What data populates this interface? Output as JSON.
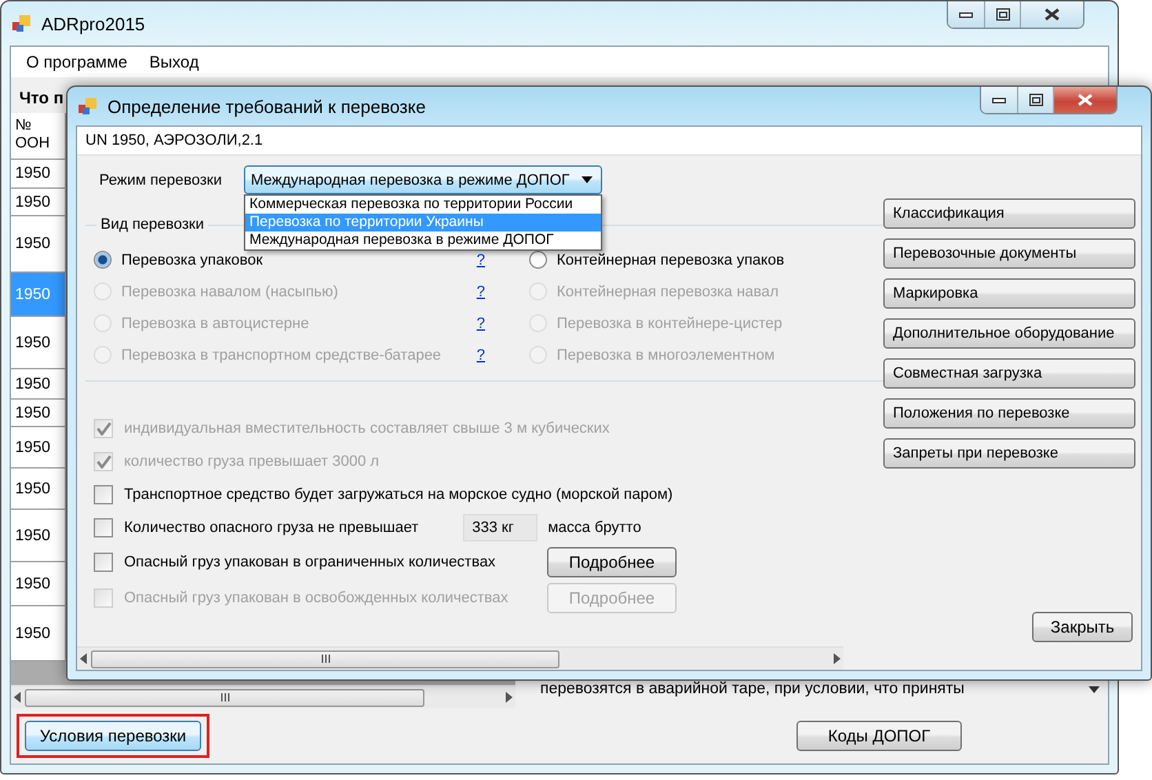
{
  "main_window": {
    "title": "ADRpro2015",
    "menu": [
      "О программе",
      "Выход"
    ],
    "section_label": "Что п",
    "table": {
      "columns": [
        "№ ООН"
      ],
      "rows": [
        {
          "un": "1950",
          "selected": false
        },
        {
          "un": "1950",
          "selected": false
        },
        {
          "un": "1950",
          "selected": false
        },
        {
          "un": "1950",
          "selected": true
        },
        {
          "un": "1950",
          "selected": false
        },
        {
          "un": "1950",
          "selected": false
        },
        {
          "un": "1950",
          "selected": false
        },
        {
          "un": "1950",
          "selected": false
        },
        {
          "un": "1950",
          "selected": false
        },
        {
          "un": "1950",
          "selected": false
        },
        {
          "un": "1950",
          "selected": false
        },
        {
          "un": "1950",
          "selected": false
        }
      ]
    },
    "description_text": "перевозятся в аварийной таре, при условии, что приняты",
    "buttons": [
      {
        "label": "Условия перевозки",
        "highlighted": true
      },
      {
        "label": "Коды ДОПОГ",
        "highlighted": false
      }
    ]
  },
  "dialog": {
    "title": "Определение требований к перевозке",
    "substance": "UN 1950, АЭРОЗОЛИ,2.1",
    "mode_label": "Режим перевозки",
    "mode_value": "Международная перевозка в режиме ДОПОГ",
    "mode_options": [
      {
        "label": "Коммерческая перевозка по территории России",
        "selected": false
      },
      {
        "label": "Перевозка по территории Украины",
        "selected": true
      },
      {
        "label": "Международная перевозка в режиме ДОПОГ",
        "selected": false
      }
    ],
    "group_title": "Вид перевозки",
    "transport_types_left": [
      {
        "label": "Перевозка упаковок",
        "selected": true,
        "disabled": false,
        "help": "?"
      },
      {
        "label": "Перевозка навалом (насыпью)",
        "selected": false,
        "disabled": true,
        "help": "?"
      },
      {
        "label": "Перевозка в автоцистерне",
        "selected": false,
        "disabled": true,
        "help": "?"
      },
      {
        "label": "Перевозка в транспортном средстве-батарее",
        "selected": false,
        "disabled": true,
        "help": "?"
      }
    ],
    "transport_types_right": [
      {
        "label": "Контейнерная перевозка упаков",
        "selected": false,
        "disabled": false
      },
      {
        "label": "Контейнерная перевозка навал",
        "selected": false,
        "disabled": true
      },
      {
        "label": "Перевозка в контейнере-цистер",
        "selected": false,
        "disabled": true
      },
      {
        "label": "Перевозка в многоэлементном",
        "selected": false,
        "disabled": true
      }
    ],
    "options": [
      {
        "kind": "plain",
        "label": "индивидуальная вместительность  составляет свыше 3 м кубических",
        "checked": true,
        "disabled": true
      },
      {
        "kind": "plain",
        "label": "количество груза превышает 3000 л",
        "checked": true,
        "disabled": true
      },
      {
        "kind": "plain",
        "label": "Транспортное средство будет загружаться на морское судно (морской паром)",
        "checked": false,
        "disabled": false
      },
      {
        "kind": "amount",
        "label": "Количество опасного груза не превышает",
        "checked": false,
        "disabled": false,
        "value": "333 кг",
        "suffix": "масса брутто"
      },
      {
        "kind": "details",
        "label": "Опасный груз упакован в ограниченных количествах",
        "checked": false,
        "disabled": false,
        "button": "Подробнее"
      },
      {
        "kind": "details",
        "label": "Опасный груз упакован в освобожденных количествах",
        "checked": false,
        "disabled": true,
        "button": "Подробнее"
      }
    ],
    "side_buttons": [
      "Классификация",
      "Перевозочные документы",
      "Маркировка",
      "Дополнительное оборудование",
      "Совместная загрузка",
      "Положения по перевозке",
      "Запреты при перевозке"
    ],
    "close_button": "Закрыть"
  }
}
